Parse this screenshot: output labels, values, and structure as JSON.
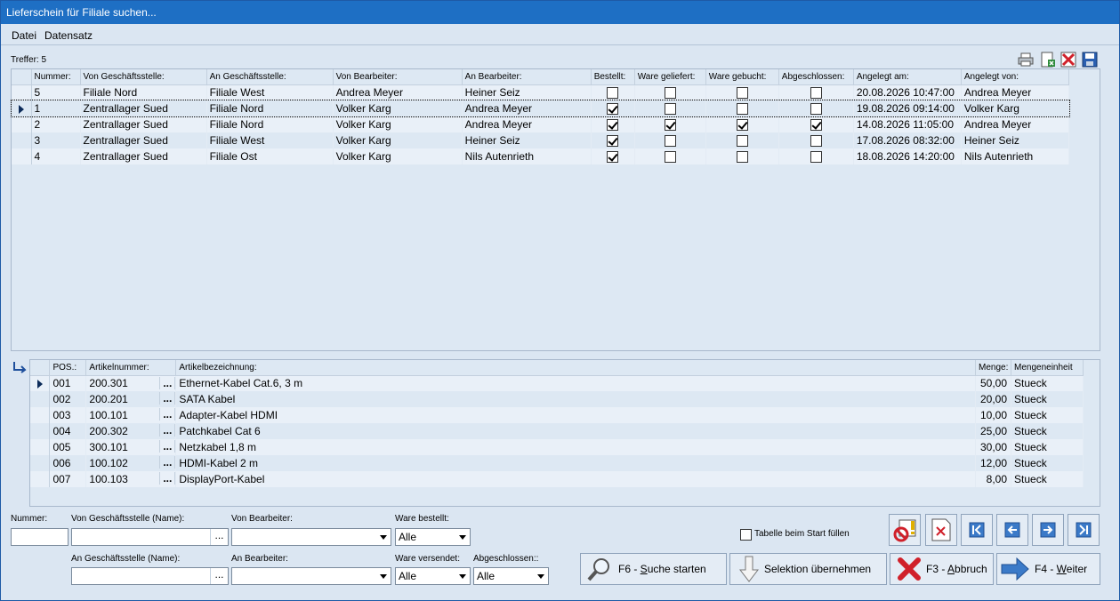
{
  "window": {
    "title": "Lieferschein für Filiale suchen..."
  },
  "menu": {
    "datei": "Datei",
    "datensatz": "Datensatz"
  },
  "treffer": "Treffer: 5",
  "toolbar_icons": [
    "printer-icon",
    "export-excel-icon",
    "delete-icon",
    "save-icon"
  ],
  "master": {
    "columns": [
      "Nummer:",
      "Von Geschäftsstelle:",
      "An Geschäftsstelle:",
      "Von Bearbeiter:",
      "An Bearbeiter:",
      "Bestellt:",
      "Ware geliefert:",
      "Ware gebucht:",
      "Abgeschlossen:",
      "Angelegt am:",
      "Angelegt von:"
    ],
    "rows": [
      {
        "nummer": "5",
        "von_gs": "Filiale Nord",
        "an_gs": "Filiale West",
        "von_b": "Andrea Meyer",
        "an_b": "Heiner Seiz",
        "bestellt": false,
        "geliefert": false,
        "gebucht": false,
        "abgeschlossen": false,
        "angelegt_am": "20.08.2026 10:47:00",
        "angelegt_von": "Andrea Meyer",
        "selected": false
      },
      {
        "nummer": "1",
        "von_gs": "Zentrallager Sued",
        "an_gs": "Filiale Nord",
        "von_b": "Volker Karg",
        "an_b": "Andrea Meyer",
        "bestellt": true,
        "geliefert": false,
        "gebucht": false,
        "abgeschlossen": false,
        "angelegt_am": "19.08.2026 09:14:00",
        "angelegt_von": "Volker Karg",
        "selected": true
      },
      {
        "nummer": "2",
        "von_gs": "Zentrallager Sued",
        "an_gs": "Filiale Nord",
        "von_b": "Volker Karg",
        "an_b": "Andrea Meyer",
        "bestellt": true,
        "geliefert": true,
        "gebucht": true,
        "abgeschlossen": true,
        "angelegt_am": "14.08.2026 11:05:00",
        "angelegt_von": "Andrea Meyer",
        "selected": false
      },
      {
        "nummer": "3",
        "von_gs": "Zentrallager Sued",
        "an_gs": "Filiale West",
        "von_b": "Volker Karg",
        "an_b": "Heiner Seiz",
        "bestellt": true,
        "geliefert": false,
        "gebucht": false,
        "abgeschlossen": false,
        "angelegt_am": "17.08.2026 08:32:00",
        "angelegt_von": "Heiner Seiz",
        "selected": false
      },
      {
        "nummer": "4",
        "von_gs": "Zentrallager Sued",
        "an_gs": "Filiale Ost",
        "von_b": "Volker Karg",
        "an_b": "Nils Autenrieth",
        "bestellt": true,
        "geliefert": false,
        "gebucht": false,
        "abgeschlossen": false,
        "angelegt_am": "18.08.2026 14:20:00",
        "angelegt_von": "Nils Autenrieth",
        "selected": false
      }
    ]
  },
  "detail": {
    "columns": [
      "POS.:",
      "Artikelnummer:",
      "Artikelbezeichnung:",
      "Menge:",
      "Mengeneinheit"
    ],
    "rows": [
      {
        "pos": "001",
        "art": "200.301",
        "bez": "Ethernet-Kabel Cat.6, 3 m",
        "menge": "50,00",
        "einheit": "Stueck"
      },
      {
        "pos": "002",
        "art": "200.201",
        "bez": "SATA Kabel",
        "menge": "20,00",
        "einheit": "Stueck"
      },
      {
        "pos": "003",
        "art": "100.101",
        "bez": "Adapter-Kabel HDMI",
        "menge": "10,00",
        "einheit": "Stueck"
      },
      {
        "pos": "004",
        "art": "200.302",
        "bez": "Patchkabel Cat 6",
        "menge": "25,00",
        "einheit": "Stueck"
      },
      {
        "pos": "005",
        "art": "300.101",
        "bez": "Netzkabel 1,8 m",
        "menge": "30,00",
        "einheit": "Stueck"
      },
      {
        "pos": "006",
        "art": "100.102",
        "bez": "HDMI-Kabel 2 m",
        "menge": "12,00",
        "einheit": "Stueck"
      },
      {
        "pos": "007",
        "art": "100.103",
        "bez": "DisplayPort-Kabel",
        "menge": "8,00",
        "einheit": "Stueck"
      }
    ],
    "dots": "..."
  },
  "filters": {
    "nummer_label": "Nummer:",
    "von_gs_label": "Von Geschäftsstelle (Name):",
    "von_b_label": "Von Bearbeiter:",
    "ware_bestellt_label": "Ware bestellt:",
    "ware_bestellt_value": "Alle",
    "an_gs_label": "An Geschäftsstelle (Name):",
    "an_b_label": "An Bearbeiter:",
    "ware_versendet_label": "Ware versendet:",
    "ware_versendet_value": "Alle",
    "abgeschlossen_label": "Abgeschlossen::",
    "abgeschlossen_value": "Alle",
    "dots": "...",
    "tabelle_fuellen": "Tabelle beim Start füllen"
  },
  "buttons": {
    "suche_prefix": "F6 - ",
    "suche_u": "S",
    "suche_rest": "uche starten",
    "selektion": "Selektion übernehmen",
    "abbruch_prefix": "F3 - ",
    "abbruch_u": "A",
    "abbruch_rest": "bbruch",
    "weiter_prefix": "F4 - ",
    "weiter_u": "W",
    "weiter_rest": "eiter"
  }
}
